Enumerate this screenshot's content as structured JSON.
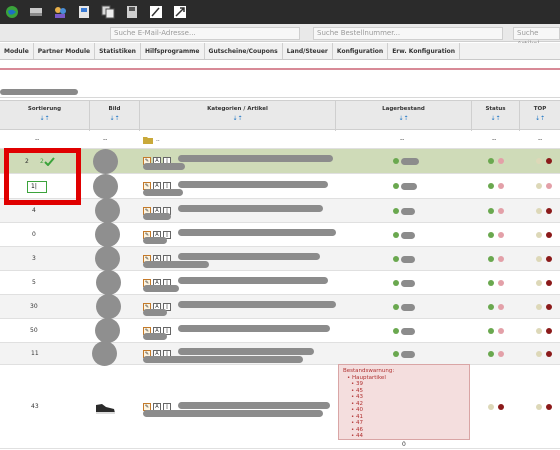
{
  "toolbar": {
    "icons": [
      "globe-icon",
      "inbox-icon",
      "users-icon",
      "contacts-icon",
      "copy-icon",
      "save-icon",
      "edit-icon",
      "link-icon"
    ]
  },
  "search": {
    "email_placeholder": "Suche E-Mail-Adresse...",
    "order_placeholder": "Suche Bestellnummer...",
    "article_placeholder": "Suche Artikel"
  },
  "menu": {
    "items": [
      "Module",
      "Partner Module",
      "Statistiken",
      "Hilfsprogramme",
      "Gutscheine/Coupons",
      "Land/Steuer",
      "Konfiguration",
      "Erw. Konfiguration"
    ]
  },
  "table": {
    "headers": {
      "sort": "Sortierung",
      "image": "Bild",
      "category": "Kategorien / Artikel",
      "stock": "Lagerbestand",
      "status": "Status",
      "top": "TOP"
    },
    "sort_arrows": "⇣⇡",
    "parent_row": {
      "sort": "--",
      "image": "--",
      "category": "..",
      "stock": "--",
      "status": "--",
      "top": "--"
    },
    "rows": [
      {
        "sort": "2",
        "sort_new": "2"
      },
      {
        "sort": ""
      },
      {
        "sort": "4"
      },
      {
        "sort": "0"
      },
      {
        "sort": "3"
      },
      {
        "sort": "5"
      },
      {
        "sort": "30"
      },
      {
        "sort": "50"
      },
      {
        "sort": "11"
      },
      {
        "sort": "43"
      }
    ],
    "edit_input_value": "1|",
    "warning": {
      "title": "Bestandswarnung:",
      "label": "• Hauptartikel",
      "items": [
        "• 39",
        "• 45",
        "• 43",
        "• 42",
        "• 40",
        "• 41",
        "• 47",
        "• 46",
        "• 44"
      ],
      "stock_value": "0"
    }
  }
}
